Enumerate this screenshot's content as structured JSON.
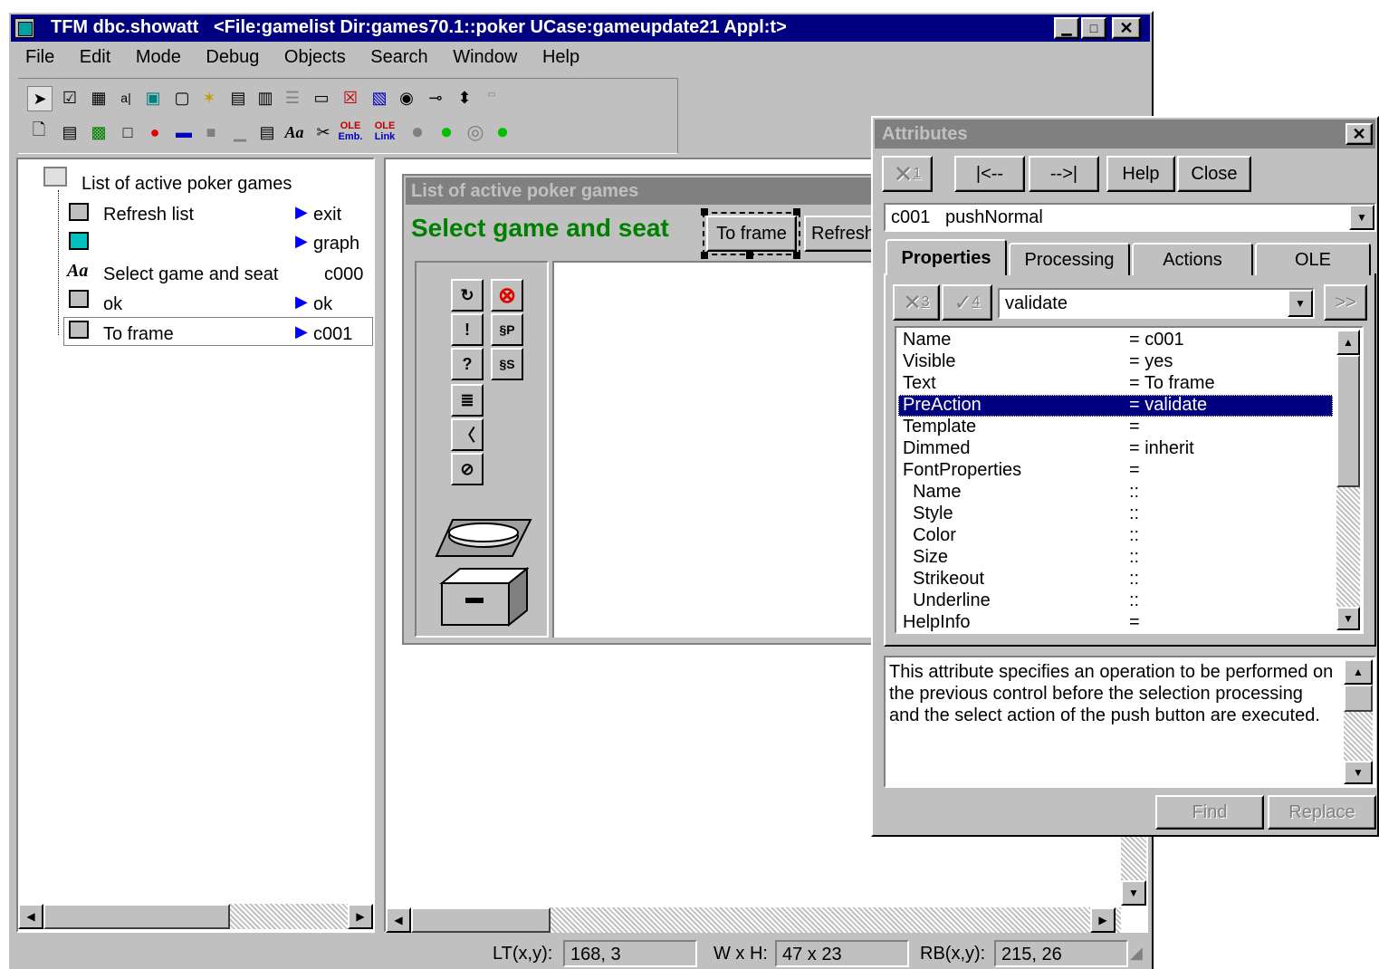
{
  "window": {
    "title": "TFM dbc.showatt   <File:gamelist Dir:games70.1::poker UCase:gameupdate21 Appl:t>"
  },
  "menu": [
    "File",
    "Edit",
    "Mode",
    "Debug",
    "Objects",
    "Search",
    "Window",
    "Help"
  ],
  "toolbar": {
    "ole_emb_top": "OLE",
    "ole_emb_bottom": "Emb.",
    "ole_link_top": "OLE",
    "ole_link_bottom": "Link"
  },
  "tree": {
    "root": "List of active poker games",
    "items": [
      {
        "label": "Refresh list",
        "value": "exit"
      },
      {
        "label": "",
        "value": "graph"
      },
      {
        "label": "Select game and seat",
        "value": "c000"
      },
      {
        "label": "ok",
        "value": "ok"
      },
      {
        "label": "To frame",
        "value": "c001"
      }
    ]
  },
  "preview": {
    "title": "List of active poker games",
    "heading": "Select game and seat",
    "btn_to_frame": "To frame",
    "btn_refresh": "Refresh"
  },
  "status": {
    "lt_label": "LT(x,y):",
    "lt_value": "168, 3",
    "wh_label": "W x H:",
    "wh_value": "47 x 23",
    "rb_label": "RB(x,y):",
    "rb_value": "215, 26"
  },
  "attributes": {
    "title": "Attributes",
    "btn_x1": "1",
    "btn_prev": "|<--",
    "btn_next": "-->|",
    "btn_help": "Help",
    "btn_close": "Close",
    "object_select": "c001   pushNormal",
    "tabs": [
      "Properties",
      "Processing",
      "Actions",
      "OLE"
    ],
    "btn_x3": "3",
    "btn_check4": "4",
    "action_select": "validate",
    "btn_more": ">>",
    "properties": [
      {
        "name": "Name",
        "value": "= c001"
      },
      {
        "name": "Visible",
        "value": "= yes"
      },
      {
        "name": "Text",
        "value": "= To frame"
      },
      {
        "name": "PreAction",
        "value": "= validate"
      },
      {
        "name": "Template",
        "value": "="
      },
      {
        "name": "Dimmed",
        "value": "= inherit"
      },
      {
        "name": "FontProperties",
        "value": "="
      },
      {
        "name": "  Name",
        "value": "::"
      },
      {
        "name": "  Style",
        "value": "::"
      },
      {
        "name": "  Color",
        "value": "::"
      },
      {
        "name": "  Size",
        "value": "::"
      },
      {
        "name": "  Strikeout",
        "value": "::"
      },
      {
        "name": "  Underline",
        "value": "::"
      },
      {
        "name": "HelpInfo",
        "value": "="
      }
    ],
    "selected_index": 3,
    "description": "This attribute specifies an operation to be performed on the previous control before the selection processing and the select action of the push button are executed.",
    "btn_find": "Find",
    "btn_replace": "Replace"
  },
  "colors": {
    "title_active": "#000080",
    "title_inactive": "#808080",
    "heading_green": "#008000",
    "face": "#c0c0c0"
  }
}
